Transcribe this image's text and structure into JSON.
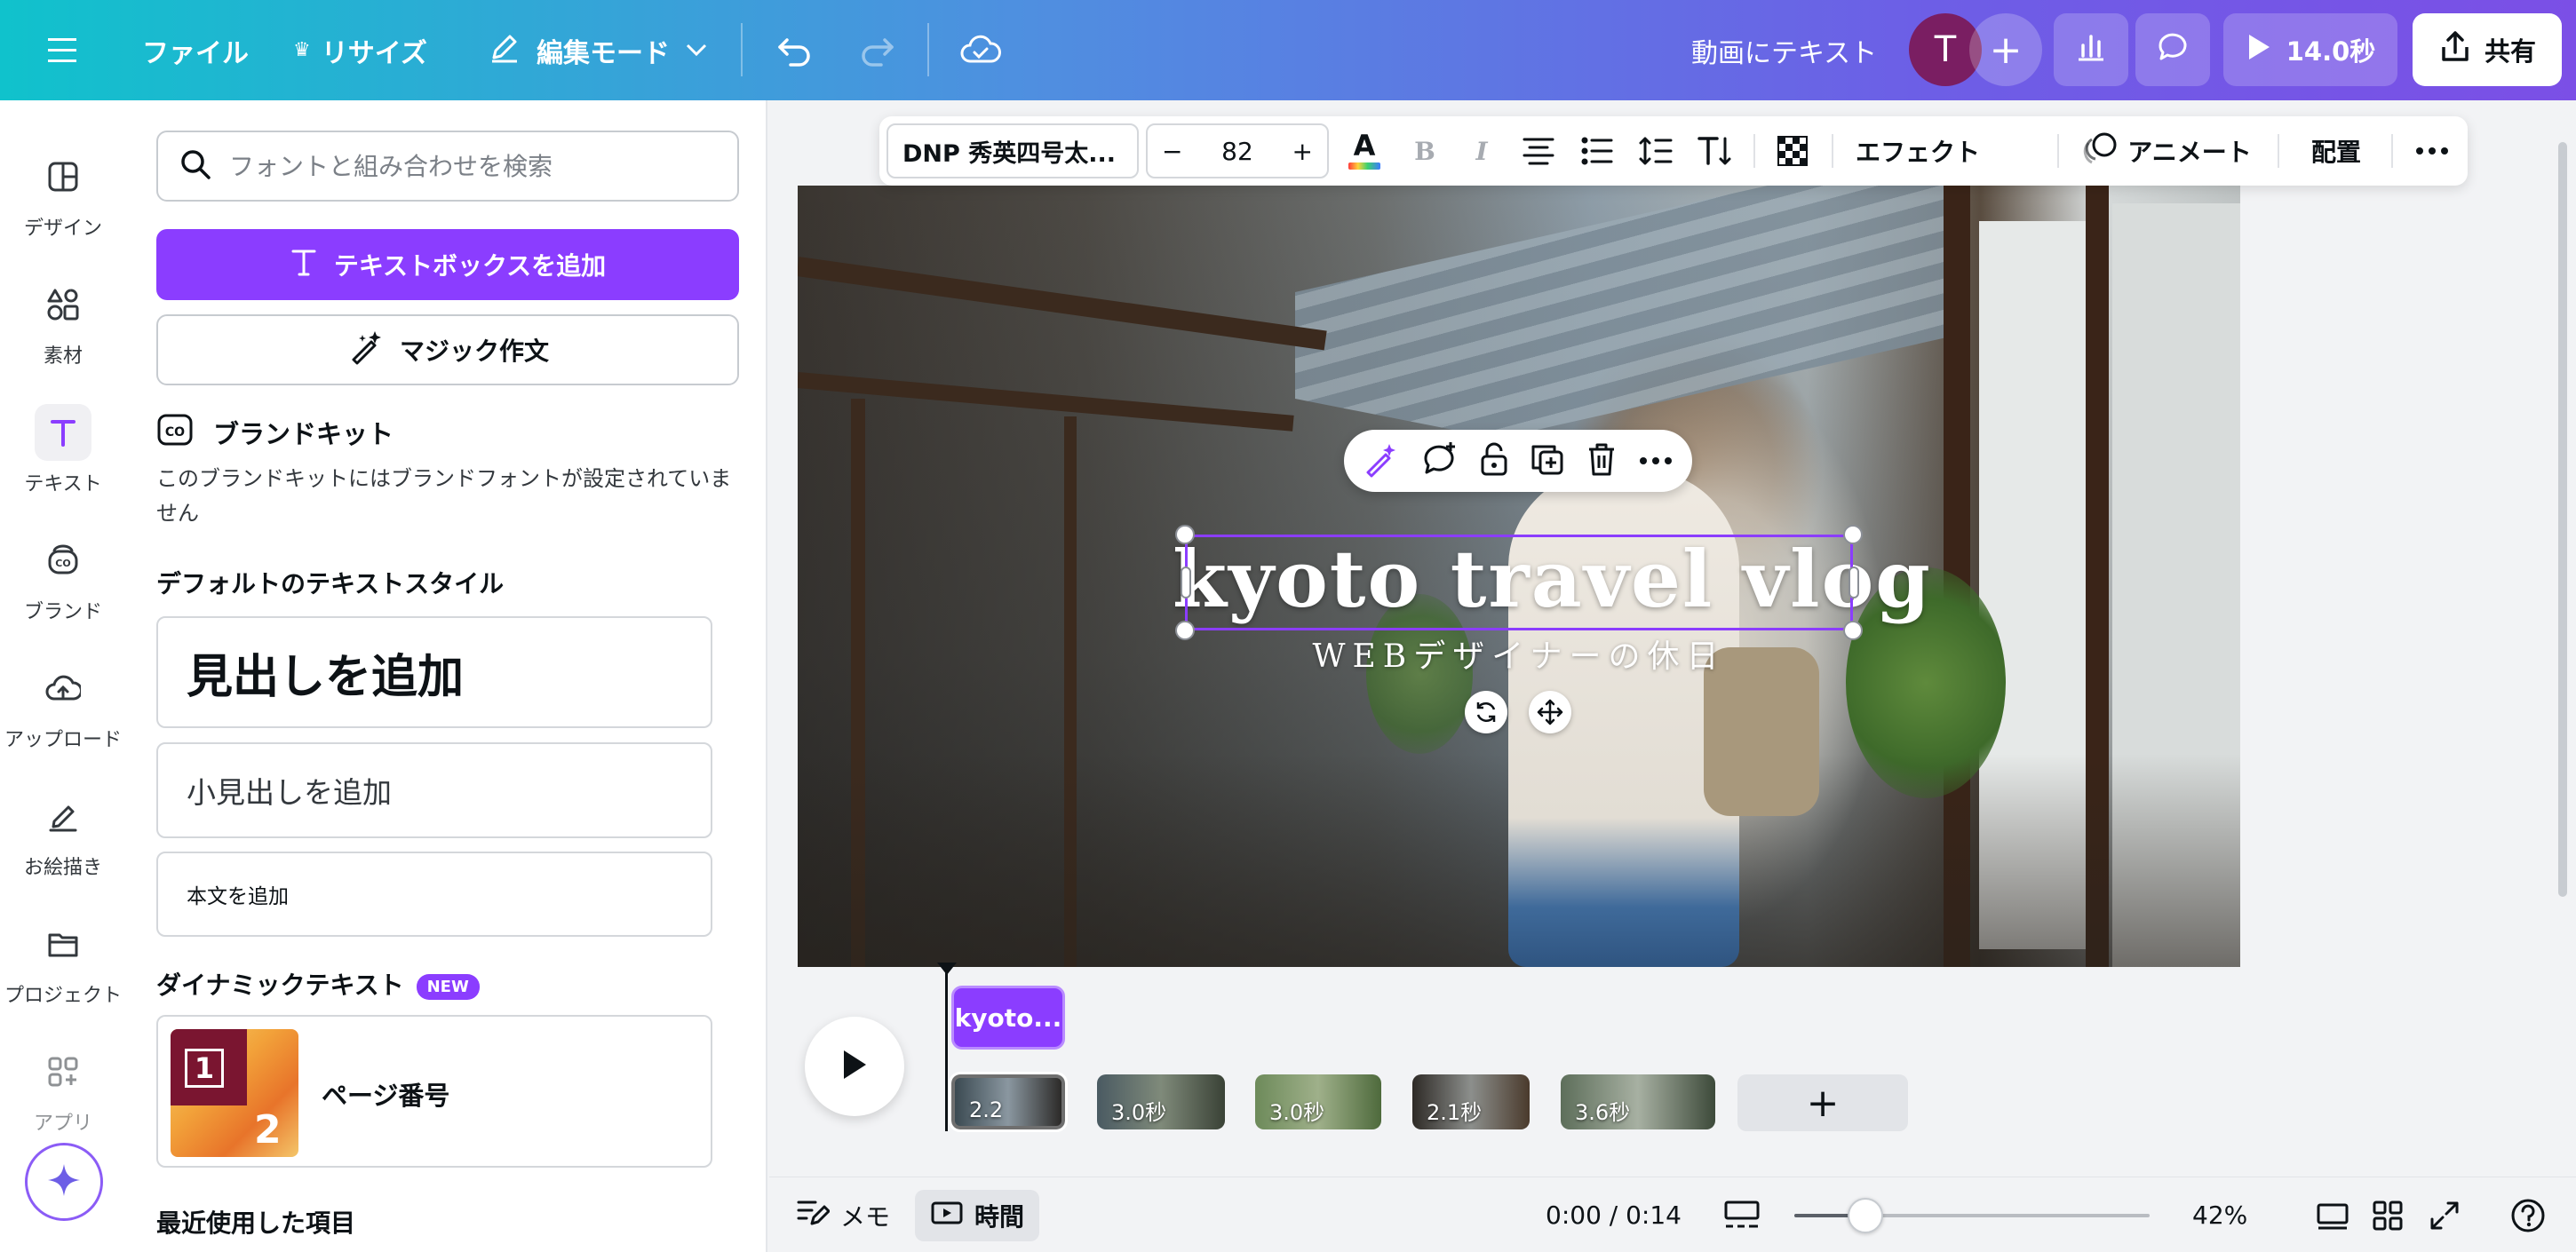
{
  "topbar": {
    "menu_icon": "hamburger-icon",
    "file_label": "ファイル",
    "resize_label": "リサイズ",
    "edit_mode_label": "編集モード",
    "doc_title": "動画にテキスト",
    "avatar_initial": "T",
    "play_duration": "14.0秒",
    "share_label": "共有"
  },
  "rail": {
    "items": [
      {
        "label": "デザイン",
        "icon": "design-icon"
      },
      {
        "label": "素材",
        "icon": "elements-icon"
      },
      {
        "label": "テキスト",
        "icon": "text-icon"
      },
      {
        "label": "ブランド",
        "icon": "brand-icon"
      },
      {
        "label": "アップロード",
        "icon": "upload-icon"
      },
      {
        "label": "お絵描き",
        "icon": "draw-icon"
      },
      {
        "label": "プロジェクト",
        "icon": "folder-icon"
      },
      {
        "label": "アプリ",
        "icon": "apps-icon"
      }
    ]
  },
  "panel": {
    "search_placeholder": "フォントと組み合わせを検索",
    "add_textbox": "テキストボックスを追加",
    "magic_write": "マジック作文",
    "brand_kit_title": "ブランドキット",
    "brand_kit_note": "このブランドキットにはブランドフォントが設定されていません",
    "default_styles_title": "デフォルトのテキストスタイル",
    "heading": "見出しを追加",
    "subheading": "小見出しを追加",
    "body": "本文を追加",
    "dynamic_title": "ダイナミックテキスト",
    "new_badge": "NEW",
    "page_number_label": "ページ番号",
    "page_number_thumb_1": "1",
    "page_number_thumb_2": "2",
    "recent_title": "最近使用した項目"
  },
  "toolbar": {
    "font_name": "DNP 秀英四号太...",
    "font_size": "82",
    "minus": "−",
    "plus": "+",
    "effects": "エフェクト",
    "animate": "アニメート",
    "position": "配置"
  },
  "canvas": {
    "title_text": "kyoto travel vlog",
    "subtitle_text": "WEBデザイナーの休日"
  },
  "timeline": {
    "text_clip_label": "kyoto...",
    "clips": [
      {
        "duration": "2.2",
        "colors": [
          "#3b4a52",
          "#8a97a0",
          "#2c2a28"
        ]
      },
      {
        "duration": "3.0秒",
        "colors": [
          "#4a5a62",
          "#7f8a7a",
          "#3a4236"
        ]
      },
      {
        "duration": "3.0秒",
        "colors": [
          "#6d8a5a",
          "#9fb08a",
          "#4e6a3c"
        ]
      },
      {
        "duration": "2.1秒",
        "colors": [
          "#2e2a26",
          "#8c8f8c",
          "#4a3a2c"
        ]
      },
      {
        "duration": "3.6秒",
        "colors": [
          "#5d6e5a",
          "#a7b0a2",
          "#3d4a3a"
        ]
      }
    ],
    "add_label": "+"
  },
  "bottombar": {
    "notes_label": "メモ",
    "time_label": "時間",
    "time_readout": "0:00 / 0:14",
    "zoom_fraction": 0.2,
    "zoom_label": "42%"
  },
  "colors": {
    "accent": "#8b3dff",
    "topbar_gradient_start": "#10c2cc",
    "topbar_gradient_end": "#7b4fe6"
  }
}
